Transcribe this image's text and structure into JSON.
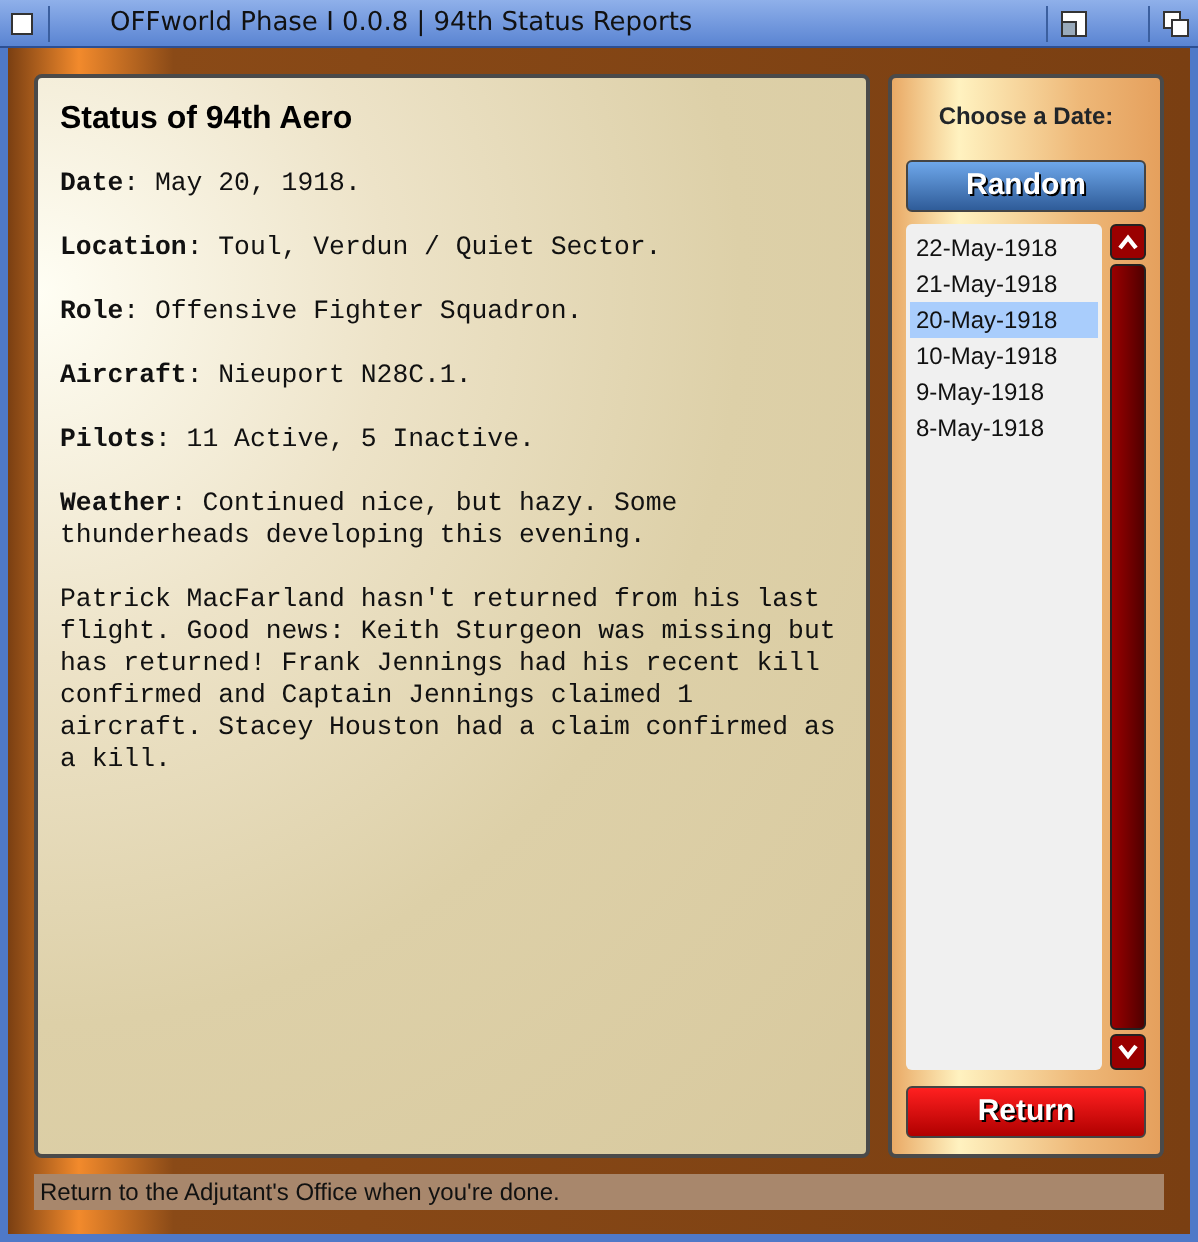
{
  "window": {
    "title": "OFFworld Phase I 0.0.8 | 94th Status Reports"
  },
  "report": {
    "heading": "Status of 94th Aero",
    "paragraphs": [
      "**Date**: May 20, 1918.",
      "**Location**: Toul, Verdun / Quiet Sector.",
      "**Role**: Offensive Fighter Squadron.",
      "**Aircraft**: Nieuport N28C.1.",
      "**Pilots**: 11 Active, 5 Inactive.",
      "**Weather**: Continued nice, but hazy. Some thunderheads developing this evening.",
      "Patrick MacFarland hasn't returned from his last flight. Good news: Keith Sturgeon was missing but has returned! Frank Jennings had his recent kill confirmed and Captain Jennings claimed 1 aircraft. Stacey Houston had a claim confirmed as a kill."
    ]
  },
  "date_panel": {
    "label": "Choose a Date:",
    "random_button": "Random",
    "dates": [
      {
        "text": "22-May-1918",
        "selected": false
      },
      {
        "text": "21-May-1918",
        "selected": false
      },
      {
        "text": "20-May-1918",
        "selected": true
      },
      {
        "text": "10-May-1918",
        "selected": false
      },
      {
        "text": "9-May-1918",
        "selected": false
      },
      {
        "text": "8-May-1918",
        "selected": false
      }
    ],
    "return_button": "Return"
  },
  "status_bar": "Return to the Adjutant's Office when you're done."
}
